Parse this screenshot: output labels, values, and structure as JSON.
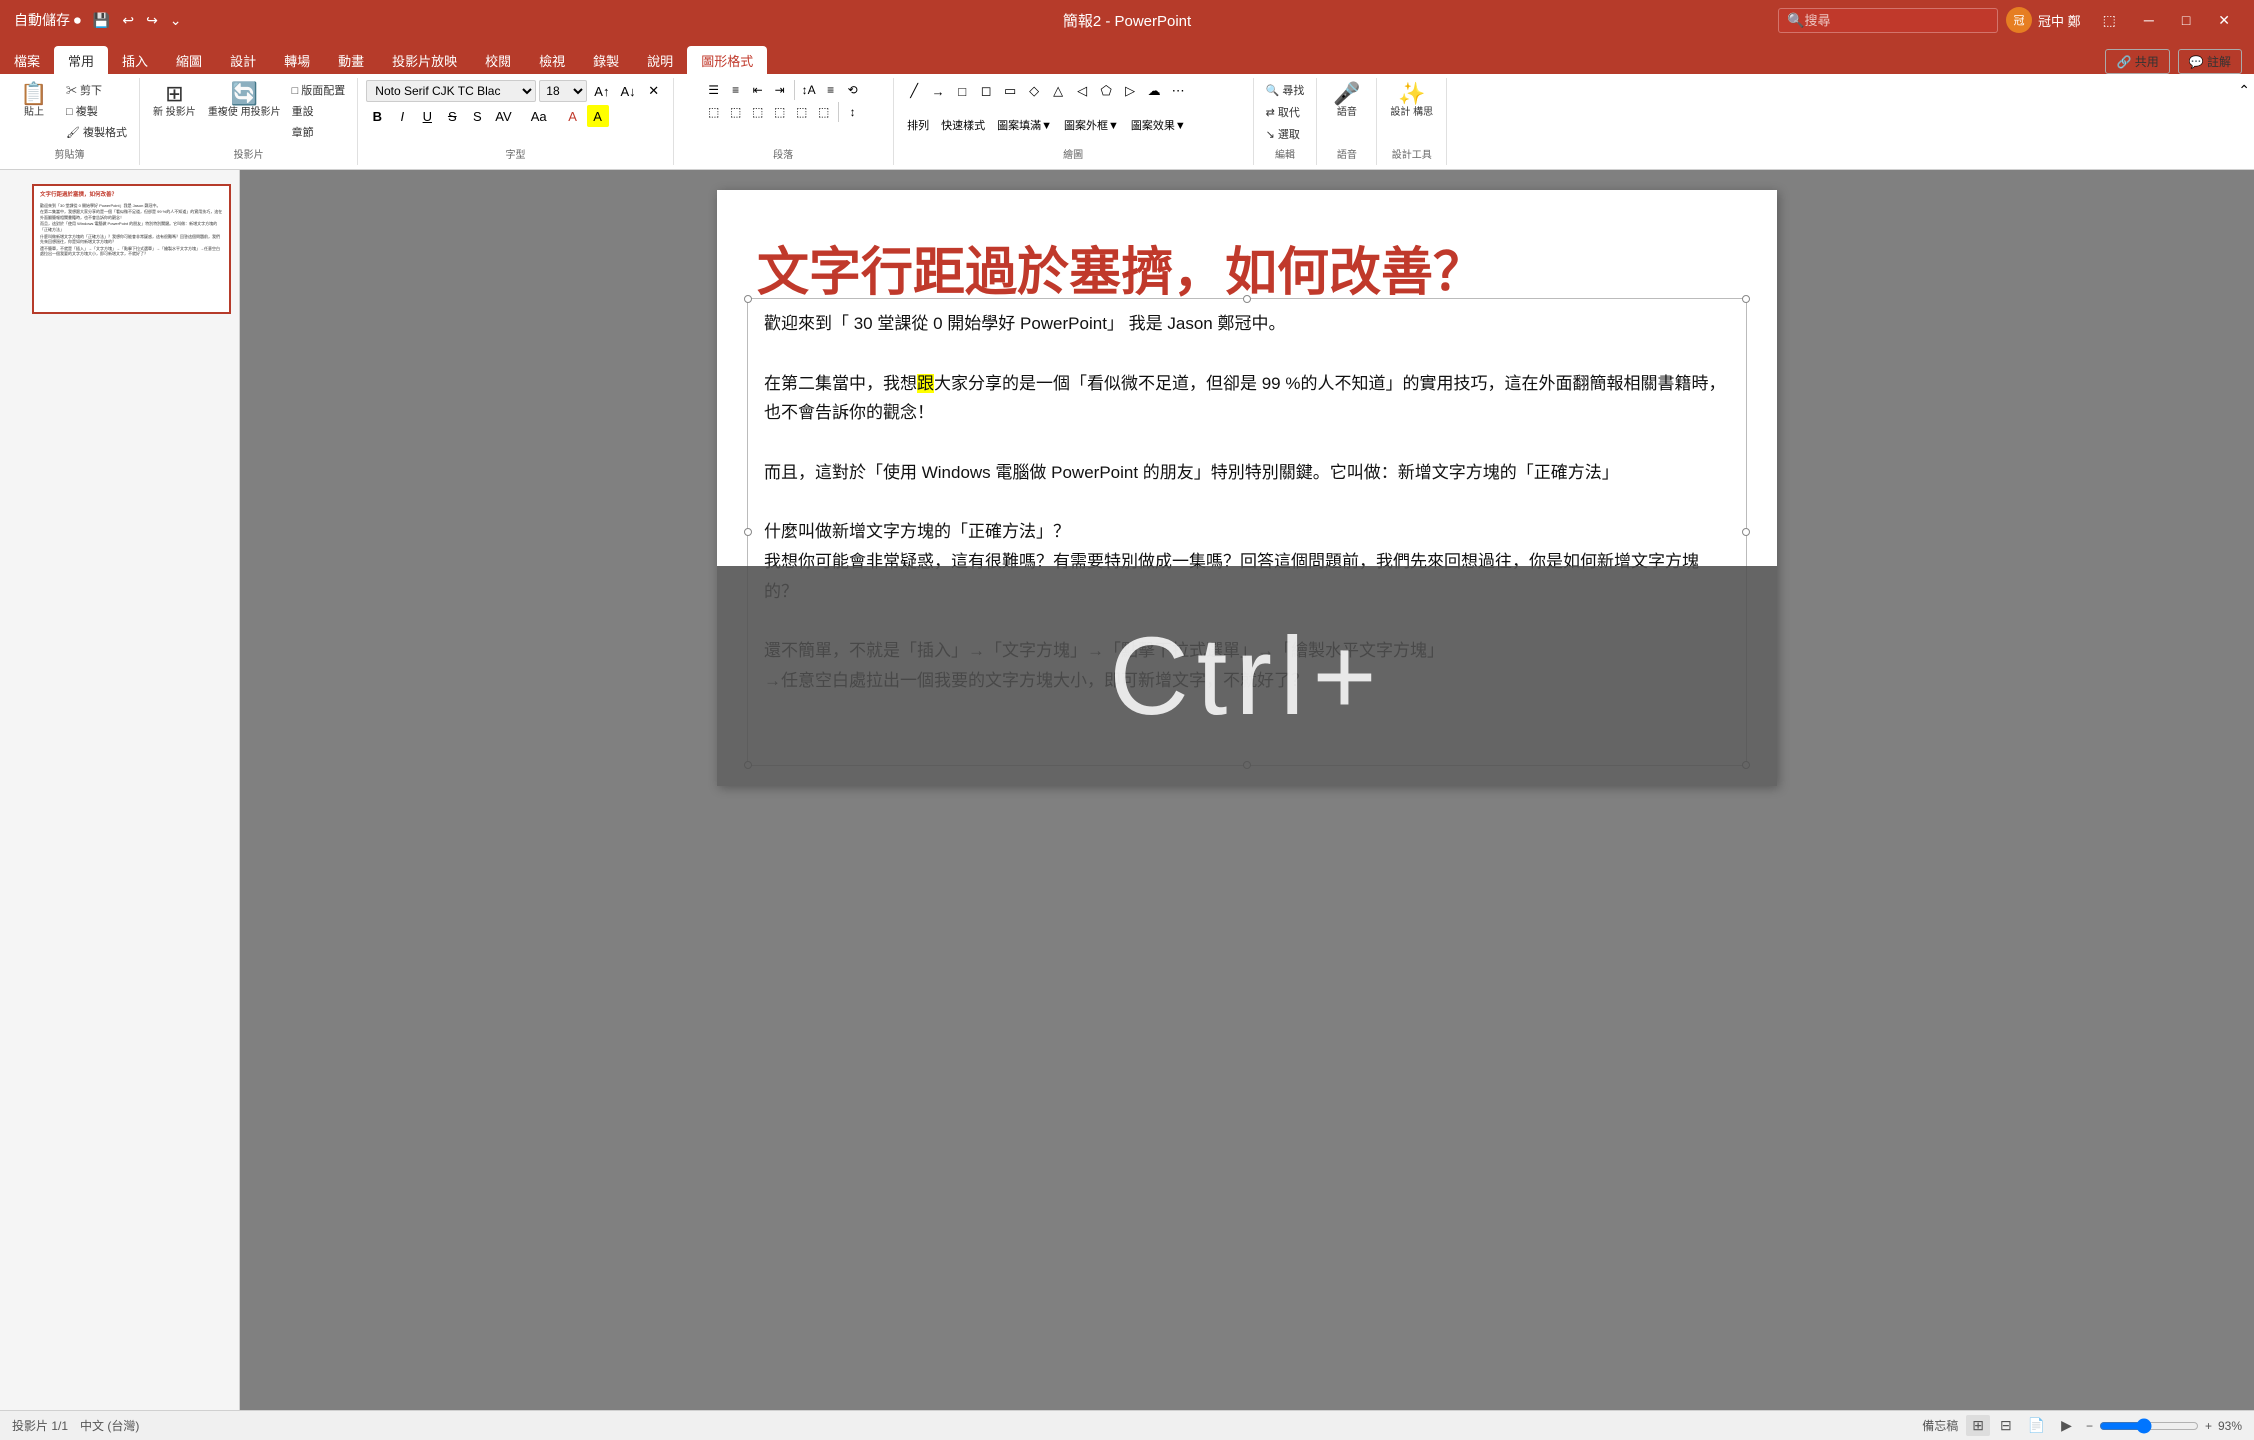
{
  "titleBar": {
    "appName": "簡報2 - PowerPoint",
    "searchPlaceholder": "搜尋",
    "userName": "冠中 鄭",
    "userInitials": "冠",
    "windowButtons": [
      "─",
      "□",
      "✕"
    ]
  },
  "quickAccess": {
    "buttons": [
      "自動儲存 ●圓",
      "儲存",
      "復原",
      "取消復原",
      "自訂"
    ]
  },
  "ribbonTabs": {
    "tabs": [
      "檔案",
      "常用",
      "插入",
      "縮圖",
      "設計",
      "轉場",
      "動畫",
      "投影片放映",
      "校閱",
      "檢視",
      "錄製",
      "說明",
      "圖形格式"
    ],
    "activeTab": "常用"
  },
  "fontToolbar": {
    "fontName": "Noto Serif CJK TC Blac",
    "fontSize": "18",
    "fontSizeUp": "A",
    "fontSizeDown": "A",
    "clearFormat": "✕",
    "bold": "B",
    "italic": "I",
    "underline": "U",
    "strikethrough": "S",
    "shadow": "S",
    "charSpacing": "AV",
    "caseChange": "Aa",
    "fontColor": "A",
    "highlight": "A"
  },
  "groups": {
    "clipboard": {
      "label": "剪貼簿",
      "paste": "貼上",
      "cut": "✂ 剪下",
      "copy": "□ 複製",
      "formatPainter": "🖌 複製格式"
    },
    "slides": {
      "label": "投影片",
      "new": "新 投影片",
      "reuse": "重複使 用投影片",
      "layout": "□ 版面配置",
      "reset": "重設",
      "section": "章節"
    },
    "font": {
      "label": "字型"
    },
    "paragraph": {
      "label": "段落"
    },
    "drawing": {
      "label": "繪圖"
    },
    "editing": {
      "label": "編輯",
      "find": "尋找",
      "replace": "取代",
      "select": "選取"
    },
    "voice": {
      "label": "語音",
      "dictate": "聽寫"
    },
    "designTools": {
      "label": "設計工具",
      "designer": "設計 構思"
    }
  },
  "slidePanel": {
    "slideNumber": "1",
    "thumbnail": {
      "title": "文字行距過於塞擠，如何改善？",
      "lines": [
        "歡迎來到「30 堂課從 0 開始學好 PowerPoint」我是 Jason 鄭冠中。",
        "在第二集當中，我想跟大家分享的是一個「看似微不足道，但卻是 99 %的人不知道」的實用技巧，這在外面翻簡報相關書籍時，也不會告訴你的觀念！",
        "而且，這對於「使用 Windows 電腦做 PowerPoint 的朋友」特別特別關鍵。它叫做：新增文字方塊的「正確方法」",
        "什麼叫做新增文字方塊的「正確方法」？我想你可能會非常疑惑，這有很難嗎？有需要特別做成一集嗎？回答這個問題前，我們先來回想過往，你是如何新增文字方塊的？",
        "還不簡單，不就是「插入」→「文字方塊」→「點擊下拉式選單」→「繪製水平文字方塊」→任意空白處拉出一個我要的文字方塊大小，即可新增文字，不就好了？"
      ]
    }
  },
  "slide": {
    "title": "文字行距過於塞擠，如何改善？",
    "paragraphs": [
      "歡迎來到「 30 堂課從 0 開始學好 PowerPoint」 我是 Jason 鄭冠中。",
      "在第二集當中，我想跟大家分享的是一個「看似微不足道，但卻是 99 %的人不知道」的實用技巧，這在外面翻簡報相關書籍時，也不會告訴你的觀念！",
      "而且，這對於「使用 Windows 電腦做 PowerPoint 的朋友」特別特別關鍵。它叫做：新增文字方塊的「正確方法」",
      "什麼叫做新增文字方塊的「正確方法」？\n我想你可能會非常疑惑，這有很難嗎？有需要特別做成一集嗎？回答這個問題前，我們先來回想過往，你是如何新增文字方塊的？",
      "還不簡單，不就是「插入」→「文字方塊」→「點擊下拉式選單」→「繪製水平文字方塊」\n→任意空白處拉出一個我要的文字方塊大小，即可新增文字，不就好了？"
    ],
    "highlightWord": "跟"
  },
  "bottomBar": {
    "slideCount": "投影片 1/1",
    "language": "中文 (台灣)",
    "accessibility": "備忘稿",
    "zoomLevel": "93%",
    "views": [
      "普通",
      "投影片瀏覽",
      "閱讀",
      "投影片放映"
    ]
  },
  "ctrlOverlay": {
    "text": "Ctrl+"
  },
  "colors": {
    "titleBarBg": "#b63b2a",
    "titleColor": "#c0392b",
    "accent": "#b63b2a",
    "slideBackground": "#ffffff",
    "highlight": "#ffff00"
  }
}
